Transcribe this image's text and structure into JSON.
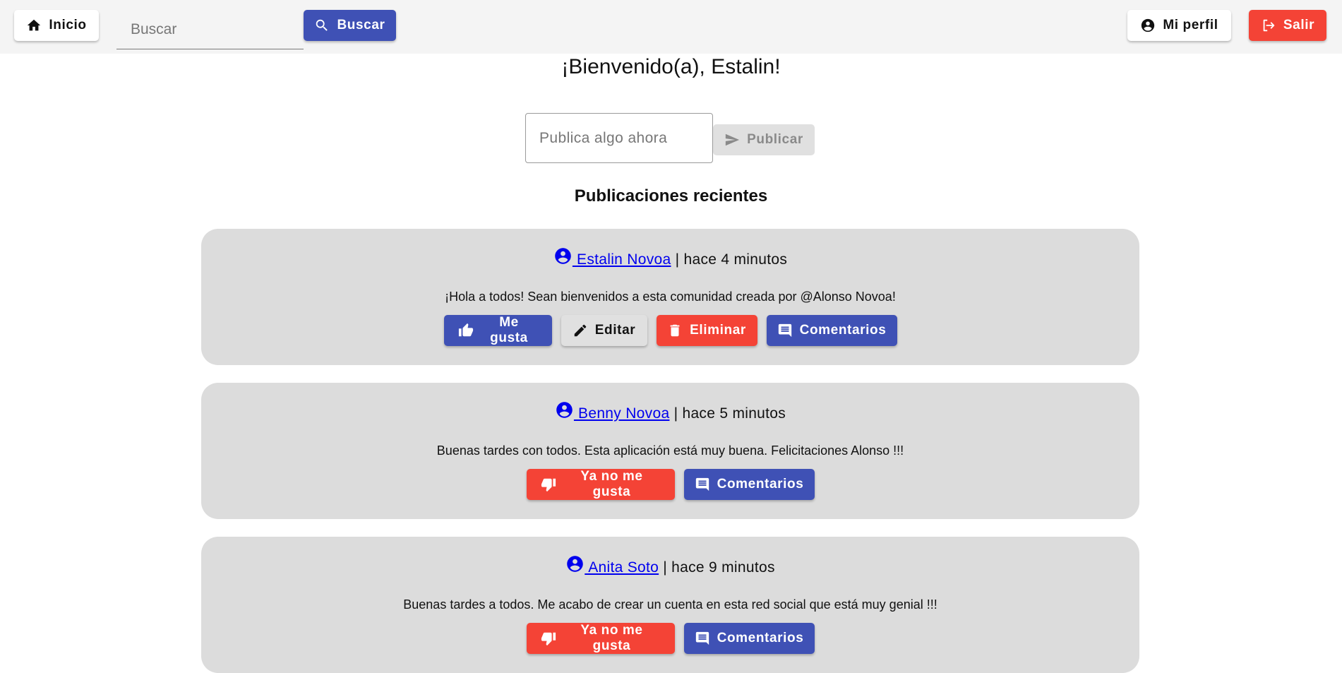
{
  "topbar": {
    "home_label": "Inicio",
    "search_placeholder": "Buscar",
    "search_button_label": "Buscar",
    "profile_label": "Mi perfil",
    "logout_label": "Salir"
  },
  "welcome": "¡Bienvenido(a), Estalin!",
  "composer": {
    "placeholder": "Publica algo ahora",
    "publish_label": "Publicar"
  },
  "section_title": "Publicaciones recientes",
  "posts": [
    {
      "author": " Estalin Novoa",
      "time": " | hace 4 minutos",
      "text": "¡Hola a todos! Sean bienvenidos a esta comunidad creada por @Alonso Novoa!",
      "like_label": "Me gusta",
      "edit_label": "Editar",
      "delete_label": "Eliminar",
      "comments_label": "Comentarios"
    },
    {
      "author": " Benny Novoa",
      "time": " | hace 5 minutos",
      "text": "Buenas tardes con todos. Esta aplicación está muy buena. Felicitaciones Alonso !!!",
      "unlike_label": "Ya no me gusta",
      "comments_label": "Comentarios"
    },
    {
      "author": " Anita Soto",
      "time": " | hace 9 minutos",
      "text": "Buenas tardes a todos. Me acabo de crear un cuenta en esta red social que está muy genial !!!",
      "unlike_label": "Ya no me gusta",
      "comments_label": "Comentarios"
    }
  ],
  "colors": {
    "primary": "#3f51b5",
    "danger": "#f44336",
    "card": "#dcdcdc",
    "topbar": "#f4f4f4",
    "link": "#0000ee"
  }
}
